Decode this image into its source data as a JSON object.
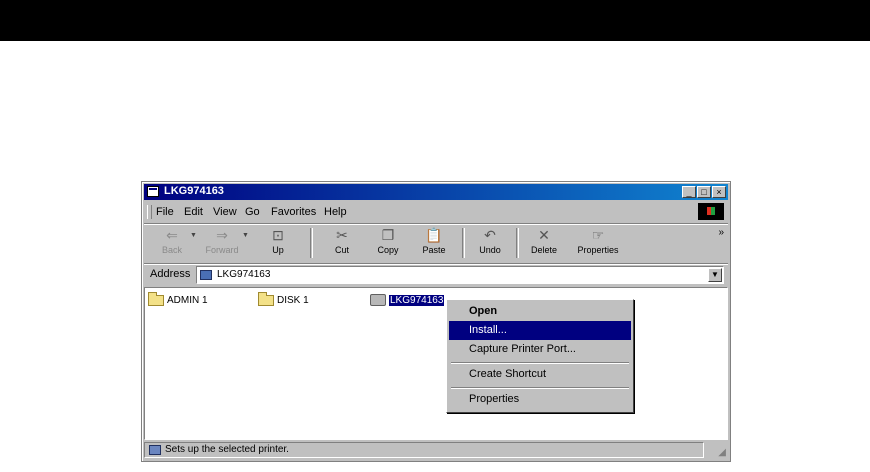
{
  "window": {
    "title": "LKG974163"
  },
  "title_buttons": {
    "minimize": "_",
    "maximize": "□",
    "close": "×"
  },
  "menubar": {
    "items": [
      "File",
      "Edit",
      "View",
      "Go",
      "Favorites",
      "Help"
    ]
  },
  "toolbar": {
    "buttons": [
      {
        "label": "Back",
        "icon": "back-arrow-icon",
        "glyph": "⇐",
        "enabled": false
      },
      {
        "label": "Forward",
        "icon": "forward-arrow-icon",
        "glyph": "⇒",
        "enabled": false
      },
      {
        "label": "Up",
        "icon": "up-folder-icon",
        "glyph": "⊡",
        "enabled": true
      },
      {
        "label": "Cut",
        "icon": "scissors-icon",
        "glyph": "✂",
        "enabled": true
      },
      {
        "label": "Copy",
        "icon": "copy-icon",
        "glyph": "❐",
        "enabled": true
      },
      {
        "label": "Paste",
        "icon": "paste-icon",
        "glyph": "📋",
        "enabled": true
      },
      {
        "label": "Undo",
        "icon": "undo-icon",
        "glyph": "↶",
        "enabled": true
      },
      {
        "label": "Delete",
        "icon": "delete-x-icon",
        "glyph": "✕",
        "enabled": true
      },
      {
        "label": "Properties",
        "icon": "properties-icon",
        "glyph": "☞",
        "enabled": true
      }
    ],
    "overflow": "»"
  },
  "address": {
    "label": "Address",
    "value": "LKG974163"
  },
  "content": {
    "items": [
      {
        "label": "ADMIN 1",
        "type": "folder",
        "selected": false
      },
      {
        "label": "DISK 1",
        "type": "folder",
        "selected": false
      },
      {
        "label": "LKG974163",
        "type": "printer",
        "selected": true
      }
    ]
  },
  "context_menu": {
    "items": [
      {
        "label": "Open",
        "bold": true,
        "hover": false
      },
      {
        "label": "Install...",
        "bold": false,
        "hover": true
      },
      {
        "label": "Capture Printer Port...",
        "bold": false,
        "hover": false
      },
      {
        "label": "Create Shortcut",
        "bold": false,
        "hover": false
      },
      {
        "label": "Properties",
        "bold": false,
        "hover": false
      }
    ]
  },
  "statusbar": {
    "text": "Sets up the selected printer."
  },
  "colors": {
    "title_active": "#000080",
    "highlight": "#000080",
    "face": "#c0c0c0"
  }
}
